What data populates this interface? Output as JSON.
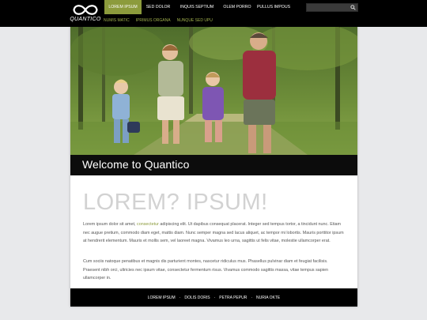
{
  "brand": {
    "logo_text": "QUANTICO"
  },
  "nav": {
    "items": [
      {
        "label": "LOREM IPSUM",
        "active": true
      },
      {
        "label": "SED DOLOR"
      },
      {
        "label": "INQUIS SEPTIUM"
      },
      {
        "label": "OLEM PORRO"
      },
      {
        "label": "PULLUS IMPOUS"
      }
    ],
    "subitems": [
      {
        "label": "NUMIS MATIC"
      },
      {
        "label": "IPRIMUS ORGANA"
      },
      {
        "label": "NUNQUE SED UPU"
      }
    ]
  },
  "search": {
    "placeholder": "",
    "icon": "search-icon"
  },
  "hero": {
    "caption": "Welcome to Quantico"
  },
  "content": {
    "heading": "LOREM? IPSUM!",
    "p1_before": "Lorem ipsum dolor sit amet, ",
    "p1_link": "consectetur",
    "p1_after": " adipiscing elit. Ut dapibus consequat placerat. Integer sed tempus tortor, a tincidunt nunc. Etiam nec augue pretium, commodo diam eget, mattis diam. Nunc semper magna sed lacus aliquet, ac tempor mi lobortis. Mauris porttitor ipsum at hendrerit elementum. Mauris et mollis sem, vel laoreet magna. Vivamus leo urna, sagittis ut felis vitae, molestie ullamcorper erat.",
    "p2": "Cum sociis natoque penatibus et magnis dis parturient montes, nascetur ridiculus mus. Phasellus pulvinar diam et feugiat facilisis. Praesent nibh orci, ultricies nec ipsum vitae, consectetur fermentum risus. Vivamus commodo sagittis massa, vitae tempus sapien ullamcorper in."
  },
  "footer": {
    "links": [
      {
        "label": "LOREM IPSUM"
      },
      {
        "label": "DOLIS DORIS"
      },
      {
        "label": "PETRA PEPUR"
      },
      {
        "label": "NURIA OKTE"
      }
    ],
    "separator": "·"
  },
  "colors": {
    "accent": "#8c9b3c",
    "topbar": "#000000",
    "background": "#e8e9eb"
  }
}
